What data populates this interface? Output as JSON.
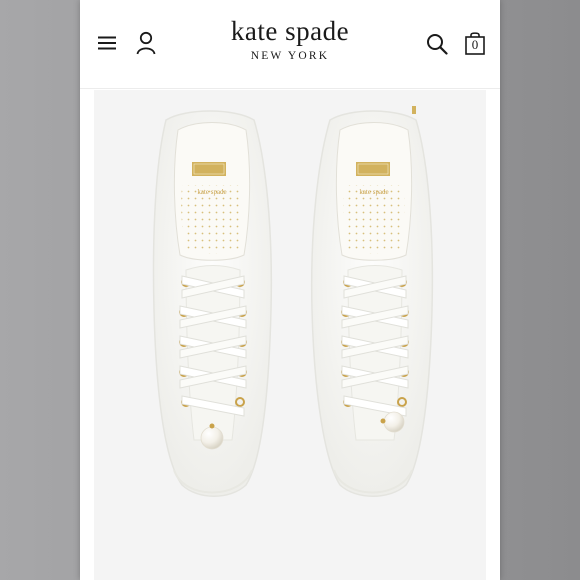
{
  "header": {
    "brand_name": "kate spade",
    "brand_sub": "NEW YORK",
    "bag_count": "0",
    "icons": [
      "menu-icon",
      "account-icon",
      "search-icon",
      "shopping-bag-icon"
    ]
  },
  "product": {
    "image": "white lace low-top sneakers with white ribbon laces, gold eyelets and pearl lace charm",
    "colors": {
      "upper": "#f8f8f6",
      "accent_gold": "#c9a24a",
      "background": "#f4f4f4"
    }
  },
  "colors": {
    "frame": "#9a9a9c",
    "header_bg": "#ffffff",
    "text": "#1a1a1a"
  }
}
